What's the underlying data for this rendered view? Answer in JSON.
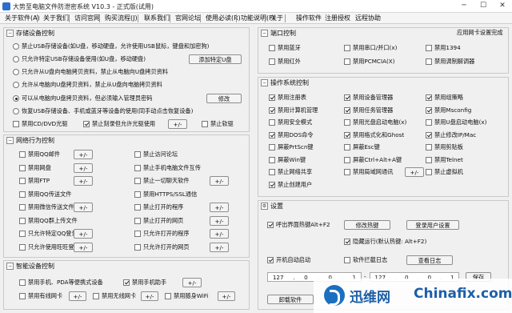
{
  "window": {
    "title": "大势至电脑文件防泄密系统 V10.3 - 正式版(试用)"
  },
  "menu": [
    "关于软件(A)",
    "关于我们",
    "访问官网",
    "购买流程(J)",
    "联系我们",
    "官网论坛",
    "使用必读(R)",
    "功能说明(F)",
    "关于",
    "操作软件",
    "注册授权",
    "远程协助"
  ],
  "storage": {
    "title": "存储设备控制",
    "radios": [
      {
        "label": "禁止USB存储设备(如U盘，移动硬盘，允许使用USB鼠标，键盘和加密狗)",
        "checked": false
      },
      {
        "label": "只允许特定USB存储设备使用(如U盘，移动硬盘)",
        "checked": false,
        "button": "添加特定U盘"
      },
      {
        "label": "只允许从U盘向电脑拷贝资料，禁止从电脑向U盘拷贝资料",
        "checked": false
      },
      {
        "label": "允许从电脑向U盘拷贝资料，禁止从U盘向电脑拷贝资料",
        "checked": false
      },
      {
        "label": "可以从电脑向U盘拷贝资料，但必须输入管理员密码",
        "checked": true,
        "button": "修改"
      },
      {
        "label": "恢复USB存储设备、手机或蓝牙等设备的使用(同手动点击恢复设备)",
        "checked": false
      }
    ],
    "bottom": [
      {
        "label": "禁用CD/DVD光驱",
        "checked": false
      },
      {
        "label": "禁止刻录但允许光驱使用",
        "checked": true,
        "button": "+/-"
      },
      {
        "label": "禁止软驱",
        "checked": false
      }
    ]
  },
  "network": {
    "title": "网络行为控制",
    "left": [
      {
        "label": "禁用QQ邮件",
        "checked": false,
        "button": "+/-"
      },
      {
        "label": "禁用网盘",
        "checked": false,
        "button": "+/-"
      },
      {
        "label": "禁用FTP",
        "checked": false,
        "button": "+/-"
      },
      {
        "label": "禁用QQ传送文件",
        "checked": false,
        "button": ""
      },
      {
        "label": "禁用微信传送文件",
        "checked": false,
        "button": "+/-"
      },
      {
        "label": "禁用QQ群上传文件",
        "checked": false,
        "button": ""
      },
      {
        "label": "只允许特定QQ登录",
        "checked": false,
        "button": "+/-"
      },
      {
        "label": "只允许使用旺旺登录",
        "checked": false,
        "button": "+/-"
      }
    ],
    "right": [
      {
        "label": "禁止访问论坛",
        "checked": false,
        "button": ""
      },
      {
        "label": "禁止手机电脑文件互传",
        "checked": false,
        "button": ""
      },
      {
        "label": "禁止一切聊天软件",
        "checked": false,
        "button": "+/-"
      },
      {
        "label": "禁用HTTPS/SSL通信",
        "checked": false,
        "button": ""
      },
      {
        "label": "禁止打开的程序",
        "checked": false,
        "button": "+/-"
      },
      {
        "label": "禁止打开的网页",
        "checked": false,
        "button": "+/-"
      },
      {
        "label": "只允许打开的程序",
        "checked": false,
        "button": "+/-"
      },
      {
        "label": "只允许打开的网页",
        "checked": false,
        "button": "+/-"
      }
    ]
  },
  "smart": {
    "title": "智能设备控制",
    "items": [
      {
        "label": "禁用手机、PDA等便携式设备",
        "checked": false,
        "button": ""
      },
      {
        "label": "禁用手机助手",
        "checked": true,
        "button": "+/-"
      },
      {
        "label": "禁用有线网卡",
        "checked": false,
        "button": "+/-"
      },
      {
        "label": "禁用无线网卡",
        "checked": false,
        "button": "+/-"
      },
      {
        "label": "禁用随身WiFi",
        "checked": false,
        "button": "+/-"
      }
    ]
  },
  "ports": {
    "title": "端口控制",
    "link": "应用网卡设置完成",
    "items": [
      {
        "label": "禁用蓝牙",
        "checked": false
      },
      {
        "label": "禁用串口/并口(x)",
        "checked": false
      },
      {
        "label": "禁用1394",
        "checked": false
      },
      {
        "label": "禁用红外",
        "checked": false
      },
      {
        "label": "禁用PCMCIA(X)",
        "checked": false
      },
      {
        "label": "禁用调制解调器",
        "checked": false
      }
    ]
  },
  "os": {
    "title": "操作系统控制",
    "items": [
      {
        "label": "禁用注册表",
        "checked": true
      },
      {
        "label": "禁用设备管理器",
        "checked": true
      },
      {
        "label": "禁用组策略",
        "checked": true
      },
      {
        "label": "禁用计算机管理",
        "checked": true
      },
      {
        "label": "禁用任务管理器",
        "checked": true
      },
      {
        "label": "禁用Msconfig",
        "checked": true
      },
      {
        "label": "禁用安全模式",
        "checked": false
      },
      {
        "label": "禁用光盘启动电脑(x)",
        "checked": false
      },
      {
        "label": "禁用U盘启动电脑(x)",
        "checked": false
      },
      {
        "label": "禁用DOS命令",
        "checked": true
      },
      {
        "label": "禁用格式化和Ghost",
        "checked": true
      },
      {
        "label": "禁止修改IP/Mac",
        "checked": true
      },
      {
        "label": "屏蔽PrtScn键",
        "checked": false
      },
      {
        "label": "屏蔽Esc键",
        "checked": false
      },
      {
        "label": "禁用剪贴板",
        "checked": false
      },
      {
        "label": "屏蔽Win键",
        "checked": false
      },
      {
        "label": "屏蔽Ctrl+Alt+A键",
        "checked": false
      },
      {
        "label": "禁用Telnet",
        "checked": false
      },
      {
        "label": "禁止网络共享",
        "checked": false
      },
      {
        "label": "禁用局域网通讯",
        "checked": false,
        "button": "+/-"
      },
      {
        "label": "禁止虚拟机",
        "checked": false
      },
      {
        "label": "禁止创建用户",
        "checked": true
      }
    ]
  },
  "settings": {
    "title": "设置",
    "hotkey": {
      "label": "呼出界面热键Alt+F2",
      "checked": true
    },
    "btn_modify_hotkey": "修改热键",
    "btn_login_user": "登录用户设置",
    "hidden": {
      "label": "隐藏运行(默认热键: Alt+F2)",
      "checked": true
    },
    "autostart": {
      "label": "开机自动启动",
      "checked": true
    },
    "blocklog": {
      "label": "软件拦截日志",
      "checked": false
    },
    "btn_view_log": "查看日志",
    "ip1": [
      "127",
      "0",
      "0",
      "1"
    ],
    "dash": "-",
    "ip2": [
      "127",
      "0",
      "0",
      "1"
    ],
    "btn_save": "保存",
    "btn_uninstall": "卸载软件"
  },
  "watermark": {
    "text_cn": "迅维网",
    "text_en": "Chinafix.com"
  }
}
